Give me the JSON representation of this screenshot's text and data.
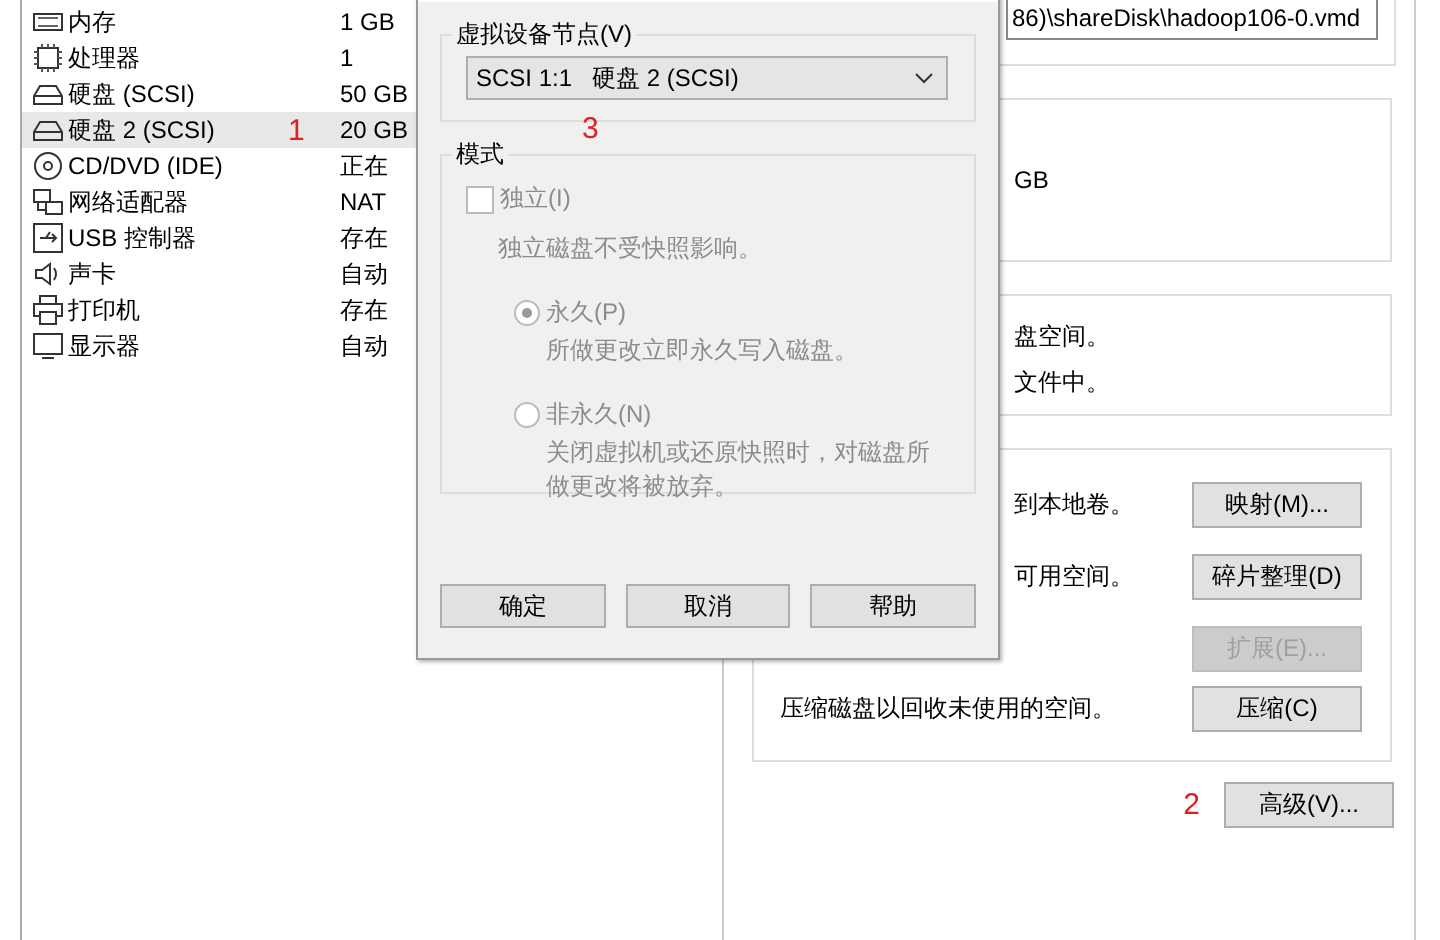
{
  "devices": [
    {
      "kind": "memory",
      "name": "内存",
      "value": "1 GB",
      "selected": false
    },
    {
      "kind": "cpu",
      "name": "处理器",
      "value": "1",
      "selected": false
    },
    {
      "kind": "disk",
      "name": "硬盘 (SCSI)",
      "value": "50 GB",
      "selected": false
    },
    {
      "kind": "disk",
      "name": "硬盘 2 (SCSI)",
      "value": "20 GB",
      "selected": true,
      "note": "1"
    },
    {
      "kind": "cdrom",
      "name": "CD/DVD (IDE)",
      "value": "正在",
      "selected": false
    },
    {
      "kind": "network",
      "name": "网络适配器",
      "value": "NAT",
      "selected": false
    },
    {
      "kind": "usb",
      "name": "USB 控制器",
      "value": "存在",
      "selected": false
    },
    {
      "kind": "sound",
      "name": "声卡",
      "value": "自动",
      "selected": false
    },
    {
      "kind": "printer",
      "name": "打印机",
      "value": "存在",
      "selected": false
    },
    {
      "kind": "display",
      "name": "显示器",
      "value": "自动",
      "selected": false
    }
  ],
  "settings": {
    "file_path": "86)\\shareDisk\\hadoop106-0.vmd",
    "capacity": "GB",
    "info_lines": [
      "盘空间。",
      "文件中。"
    ],
    "utilities": [
      {
        "kind": "clipped",
        "text": "到本地卷。",
        "button": "映射(M)...",
        "disabled": false
      },
      {
        "kind": "clipped",
        "text": "可用空间。",
        "button": "碎片整理(D)",
        "disabled": false
      },
      {
        "kind": "none",
        "button": "扩展(E)...",
        "disabled": true
      },
      {
        "kind": "full",
        "text": "压缩磁盘以回收未使用的空间。",
        "button": "压缩(C)",
        "disabled": false
      }
    ],
    "advanced_note": "2",
    "advanced_button": "高级(V)..."
  },
  "dialog": {
    "node_group": {
      "label": "虚拟设备节点(V)",
      "value": "SCSI 1:1   硬盘 2 (SCSI)",
      "note": "3"
    },
    "mode": {
      "label": "模式",
      "disabled": true,
      "independent": {
        "label": "独立(I)",
        "checked": false
      },
      "independent_desc": "独立磁盘不受快照影响。",
      "options": [
        {
          "label": "永久(P)",
          "desc": "所做更改立即永久写入磁盘。",
          "selected": true
        },
        {
          "label": "非永久(N)",
          "desc": "关闭虚拟机或还原快照时，对磁盘所做更改将被放弃。",
          "selected": false
        }
      ]
    },
    "buttons": [
      "确定",
      "取消",
      "帮助"
    ]
  }
}
